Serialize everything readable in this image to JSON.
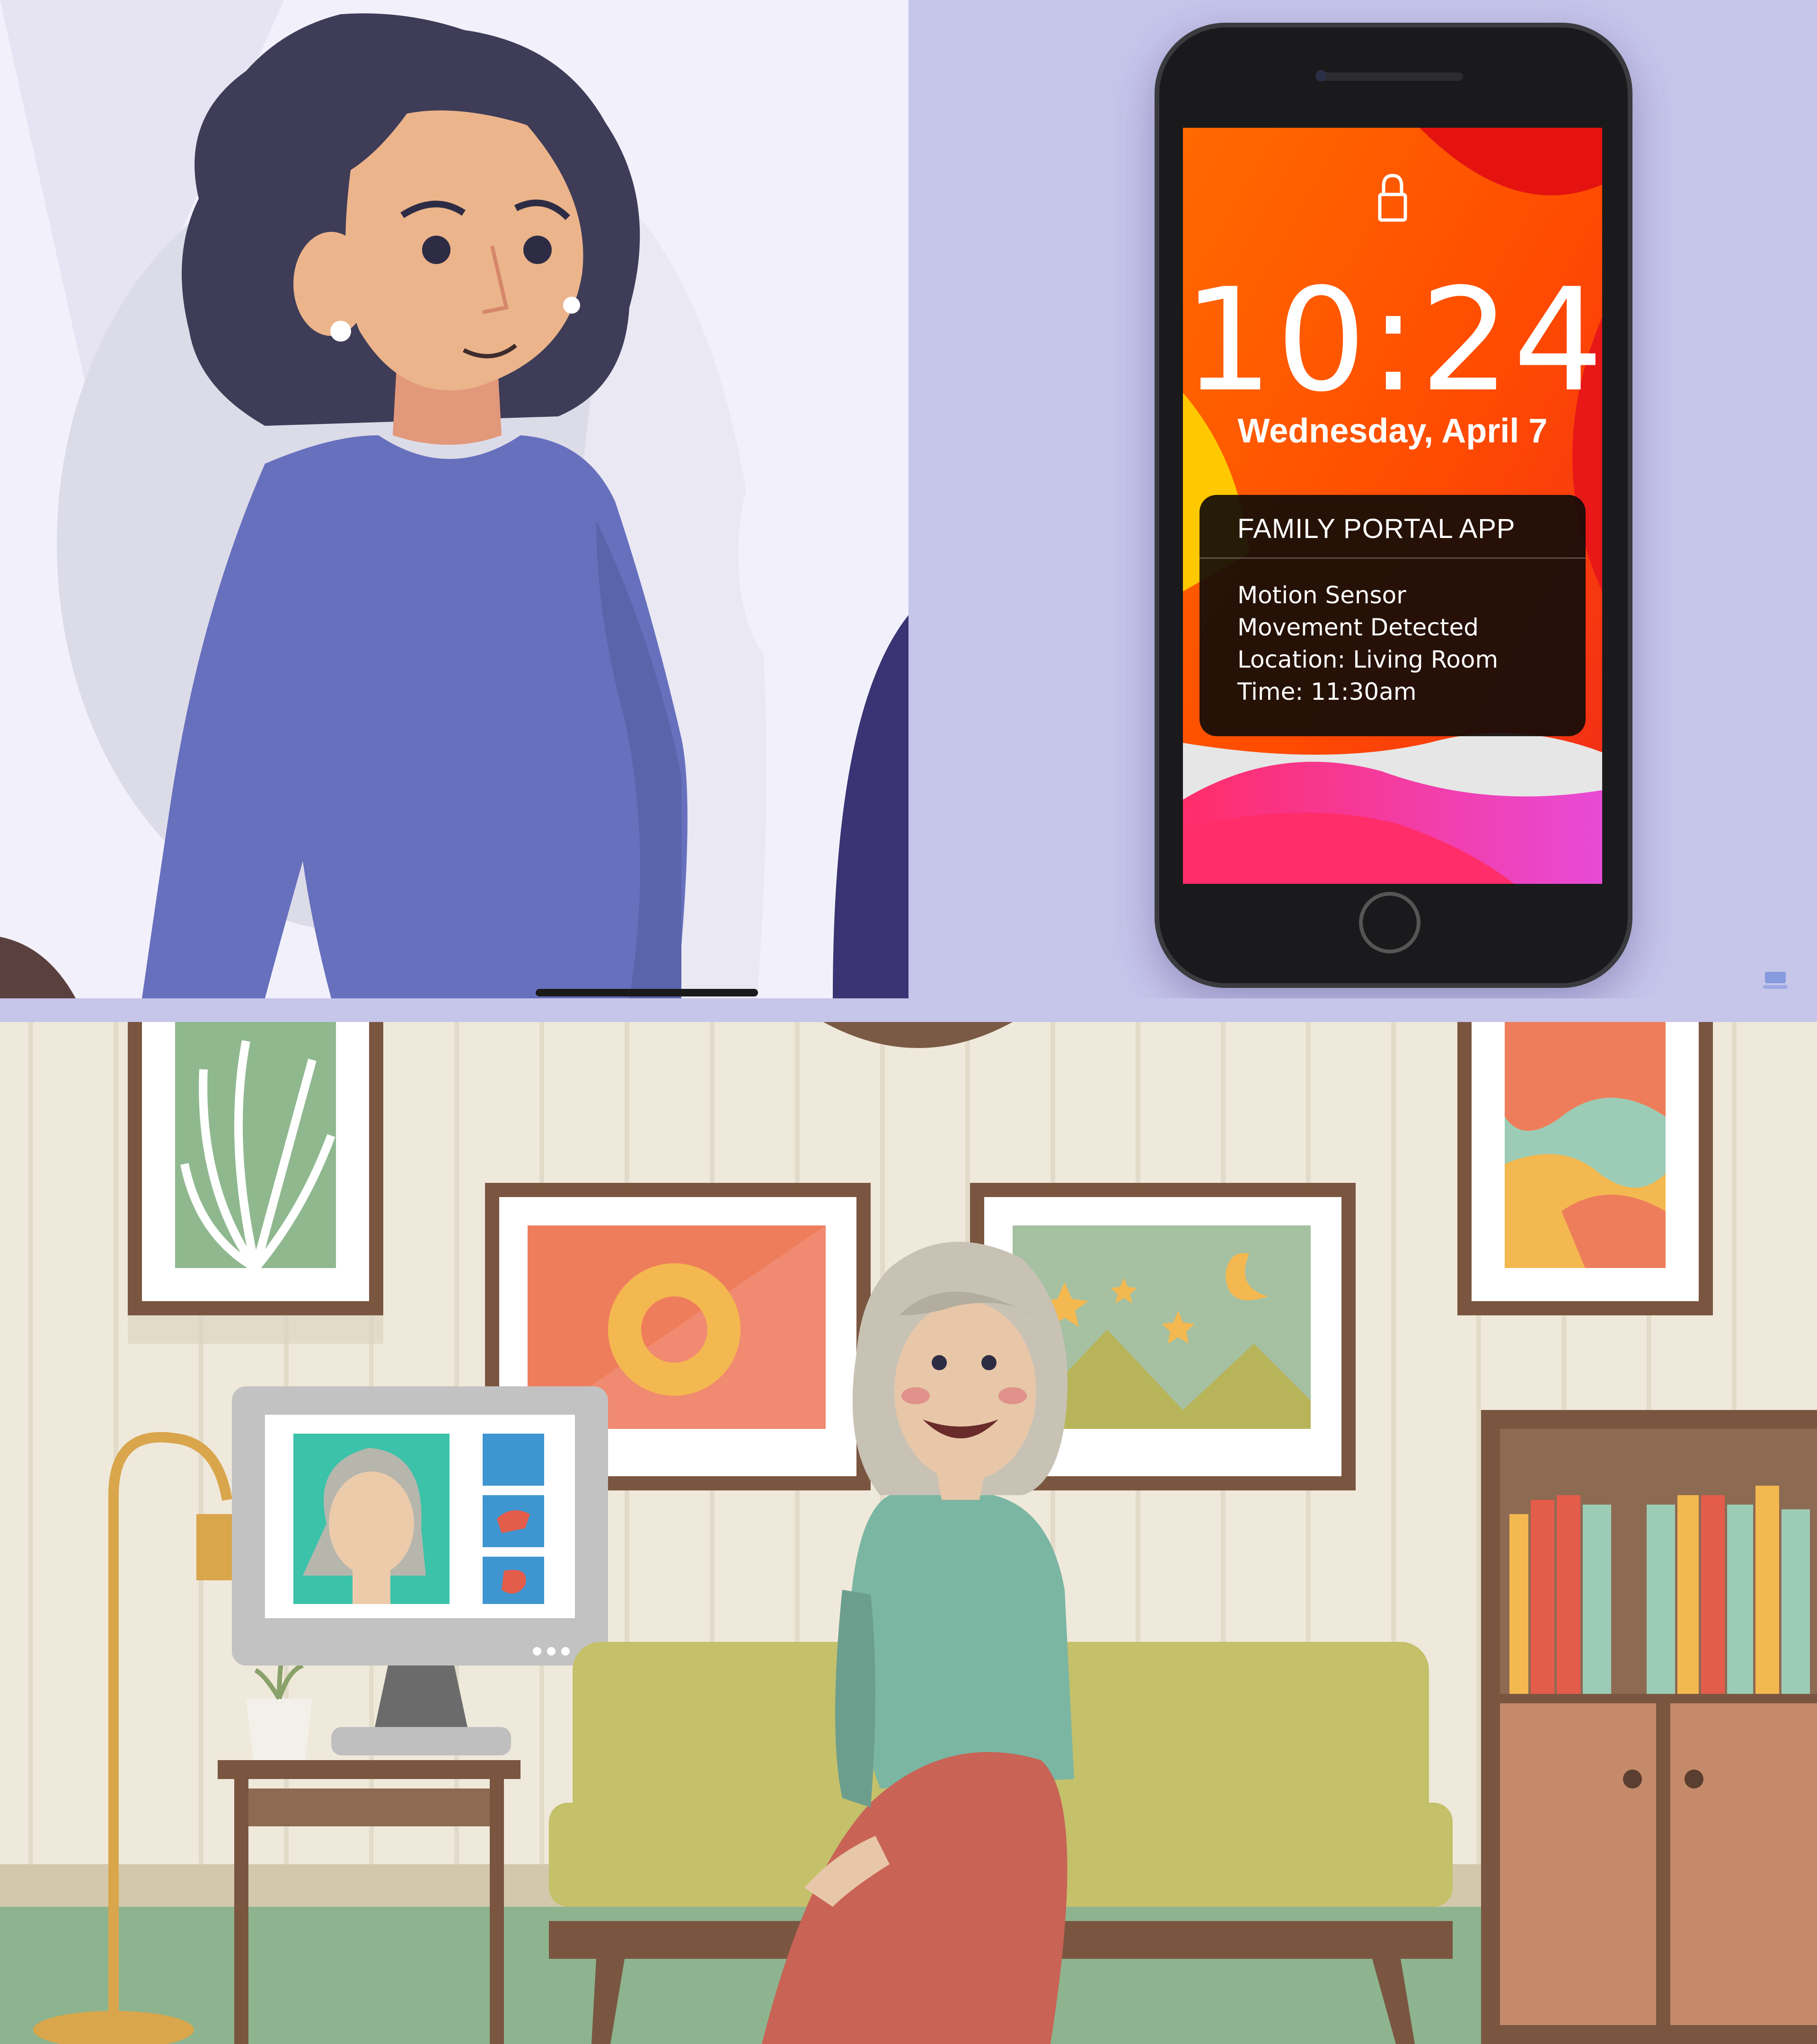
{
  "phone": {
    "lock_icon": "lock-icon",
    "time": "10:24",
    "date": "Wednesday, April 7",
    "notification": {
      "app_name": "FAMILY PORTAL APP",
      "lines": [
        "Motion Sensor",
        "Movement Detected",
        "Location: Living Room",
        "Time: 11:30am"
      ]
    }
  },
  "colors": {
    "lavender_bg": "#c6c5ea",
    "sweater_purple": "#6770bd",
    "notification_bg": "#140c08",
    "wall_stripe": "#ece5d6",
    "sofa_olive": "#c5c06a",
    "cardigan_teal": "#7bb6a3",
    "skirt_red": "#c86355"
  }
}
